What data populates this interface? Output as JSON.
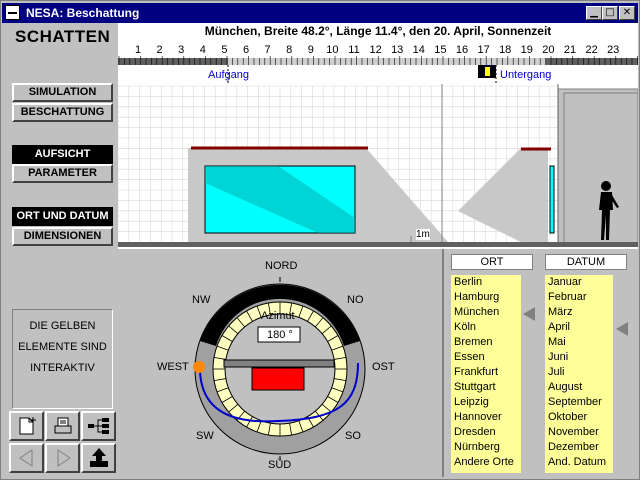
{
  "window": {
    "title": "NESA: Beschattung",
    "minimize": "▁",
    "maximize": "□",
    "close": "✕"
  },
  "left_panel": {
    "app_name": "SCHATTEN",
    "buttons": {
      "simulation": "SIMULATION",
      "beschattung": "BESCHATTUNG",
      "aufsicht": "AUFSICHT",
      "parameter": "PARAMETER",
      "ort_und_datum": "ORT UND DATUM",
      "dimensionen": "DIMENSIONEN"
    },
    "info_lines": [
      "DIE GELBEN",
      "ELEMENTE SIND",
      "INTERAKTIV"
    ]
  },
  "header": {
    "text": "München,  Breite 48.2°,  Länge 11.4°,  den 20. April,  Sonnenzeit"
  },
  "timeline": {
    "hours": [
      "1",
      "2",
      "3",
      "4",
      "5",
      "6",
      "7",
      "8",
      "9",
      "10",
      "11",
      "12",
      "13",
      "14",
      "15",
      "16",
      "17",
      "18",
      "19",
      "20",
      "21",
      "22",
      "23"
    ],
    "sunrise_label": "Aufgang",
    "sunset_label": "Untergang"
  },
  "scale": {
    "label": "1m"
  },
  "compass": {
    "north": "NORD",
    "northwest": "NW",
    "northeast": "NO",
    "west": "WEST",
    "east": "OST",
    "southwest": "SW",
    "southeast": "SO",
    "south": "SÜD",
    "azimuth_label": "Azimut",
    "azimuth_value": "180 °"
  },
  "ort": {
    "header": "ORT",
    "items": [
      "Berlin",
      "Hamburg",
      "München",
      "Köln",
      "Bremen",
      "Essen",
      "Frankfurt",
      "Stuttgart",
      "Leipzig",
      "Hannover",
      "Dresden",
      "Nürnberg",
      "Andere Orte"
    ]
  },
  "datum": {
    "header": "DATUM",
    "items": [
      "Januar",
      "Februar",
      "März",
      "April",
      "Mai",
      "Juni",
      "Juli",
      "August",
      "September",
      "Oktober",
      "November",
      "Dezember",
      "And. Datum"
    ]
  },
  "colors": {
    "title_bg": "#000080",
    "list_bg": "#ffff99",
    "window_cyan": "#00ffff",
    "wall_red": "#ff0000",
    "sun_path": "#0000cc",
    "sun_marker": "#ff8800"
  }
}
